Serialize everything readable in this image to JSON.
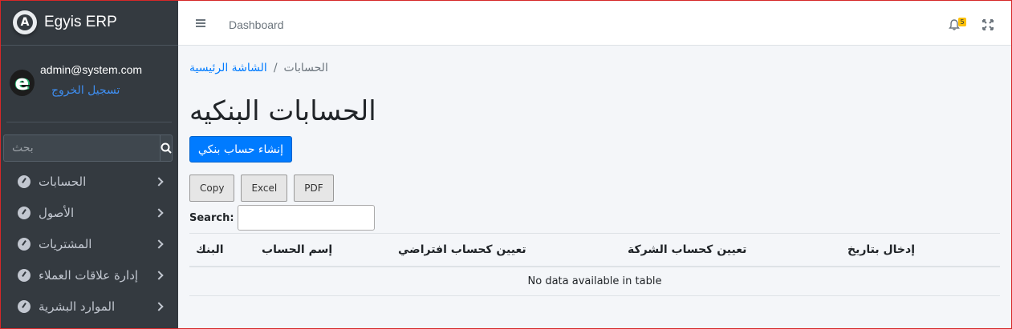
{
  "brand": {
    "logo_letter": "A",
    "name": "Egyis ERP"
  },
  "user": {
    "avatar_letter": "e",
    "email": "admin@system.com",
    "logout_label": "تسجيل الخروج"
  },
  "sidebar_search": {
    "placeholder": "بحث"
  },
  "sidebar": {
    "items": [
      {
        "label": "الحسابات"
      },
      {
        "label": "الأصول"
      },
      {
        "label": "المشتريات"
      },
      {
        "label": "إدارة علاقات العملاء"
      },
      {
        "label": "الموارد البشرية"
      }
    ]
  },
  "topbar": {
    "dashboard_label": "Dashboard",
    "notification_count": "5"
  },
  "breadcrumb": {
    "home": "الشاشة الرئيسية",
    "separator": "/",
    "current": "الحسابات"
  },
  "page": {
    "title": "الحسابات البنكيه",
    "create_button": "إنشاء حساب بنكي"
  },
  "export_buttons": {
    "copy": "Copy",
    "excel": "Excel",
    "pdf": "PDF"
  },
  "table_search": {
    "label": "Search:"
  },
  "table": {
    "columns": [
      "البنك",
      "إسم الحساب",
      "تعيين كحساب افتراضي",
      "تعيين كحساب الشركة",
      "إدخال بتاريخ"
    ],
    "empty_message": "No data available in table"
  },
  "colors": {
    "primary": "#007bff",
    "sidebar_bg": "#343a40",
    "badge": "#ffc107"
  }
}
